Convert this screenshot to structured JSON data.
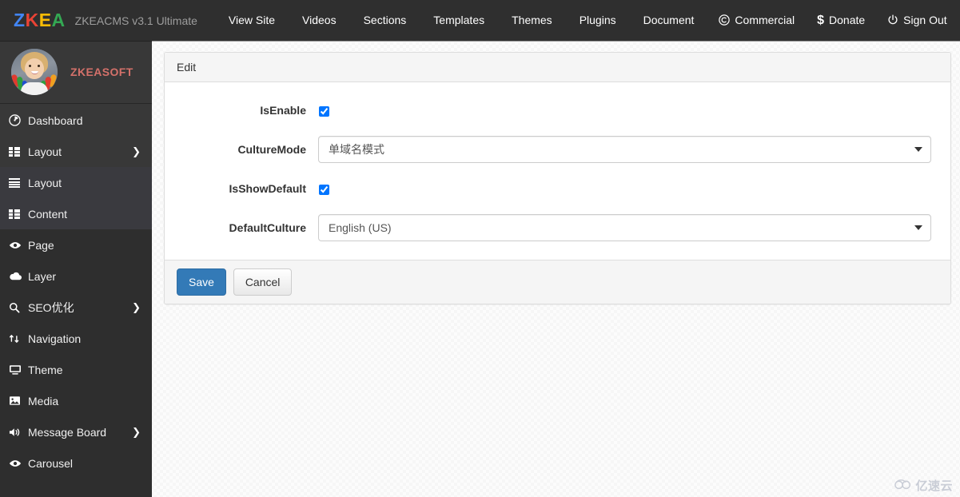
{
  "navbar": {
    "brand_letters": [
      {
        "char": "Z",
        "color": "#4285f4"
      },
      {
        "char": "K",
        "color": "#ea4335"
      },
      {
        "char": "E",
        "color": "#fbbc05"
      },
      {
        "char": "A",
        "color": "#34a853"
      }
    ],
    "version_text": "ZKEACMS v3.1 Ultimate",
    "links": [
      {
        "label": "View Site"
      },
      {
        "label": "Videos"
      },
      {
        "label": "Sections"
      },
      {
        "label": "Templates"
      },
      {
        "label": "Themes"
      },
      {
        "label": "Plugins"
      },
      {
        "label": "Document"
      }
    ],
    "right_links": [
      {
        "label": "Commercial",
        "icon": "copyright-icon",
        "glyph": "©"
      },
      {
        "label": "Donate",
        "icon": "dollar-icon",
        "glyph": "$"
      },
      {
        "label": "Sign Out",
        "icon": "power-off-icon",
        "glyph": "⏻"
      }
    ]
  },
  "sidebar": {
    "user": {
      "name": "ZKEASOFT",
      "avatar_alt": "child-with-painted-hands-avatar"
    },
    "groups": [
      {
        "name": "primary",
        "items": [
          {
            "label": "Dashboard",
            "icon": "dashboard-icon",
            "glyph": "◔",
            "arrow": ""
          },
          {
            "label": "Layout",
            "icon": "th-list-icon",
            "glyph": "grid",
            "arrow": "❯"
          }
        ]
      },
      {
        "name": "layout-section",
        "items": [
          {
            "label": "Layout",
            "icon": "bars-icon",
            "glyph": "lines",
            "arrow": ""
          },
          {
            "label": "Content",
            "icon": "th-list-icon",
            "glyph": "grid",
            "arrow": ""
          }
        ]
      },
      {
        "name": "modules",
        "items": [
          {
            "label": "Page",
            "icon": "eye-icon",
            "glyph": "◉",
            "arrow": ""
          },
          {
            "label": "Layer",
            "icon": "cloud-icon",
            "glyph": "☁",
            "arrow": ""
          },
          {
            "label": "SEO优化",
            "icon": "search-icon",
            "glyph": "⌕",
            "arrow": "❯"
          },
          {
            "label": "Navigation",
            "icon": "exchange-icon",
            "glyph": "⇅",
            "arrow": ""
          },
          {
            "label": "Theme",
            "icon": "desktop-icon",
            "glyph": "▭",
            "arrow": ""
          },
          {
            "label": "Media",
            "icon": "image-icon",
            "glyph": "⛰",
            "arrow": ""
          },
          {
            "label": "Message Board",
            "icon": "volume-up-icon",
            "glyph": "ὐA",
            "arrow": "❯"
          },
          {
            "label": "Carousel",
            "icon": "eye-icon",
            "glyph": "◉",
            "arrow": ""
          }
        ]
      }
    ]
  },
  "panel": {
    "heading": "Edit",
    "fields": [
      {
        "label": "IsEnable",
        "type": "checkbox",
        "checked": true
      },
      {
        "label": "CultureMode",
        "type": "select",
        "value": "单域名模式"
      },
      {
        "label": "IsShowDefault",
        "type": "checkbox",
        "checked": true
      },
      {
        "label": "DefaultCulture",
        "type": "select",
        "value": "English (US)"
      }
    ],
    "buttons": {
      "save_label": "Save",
      "cancel_label": "Cancel"
    }
  },
  "watermark": {
    "text": "亿速云",
    "logo": "cloud-logo-icon"
  },
  "colors": {
    "navbar_bg": "#2f2f2f",
    "sidebar_bg": "#2e2e2e",
    "accent_primary": "#337ab7",
    "username_color": "#d4716a"
  }
}
